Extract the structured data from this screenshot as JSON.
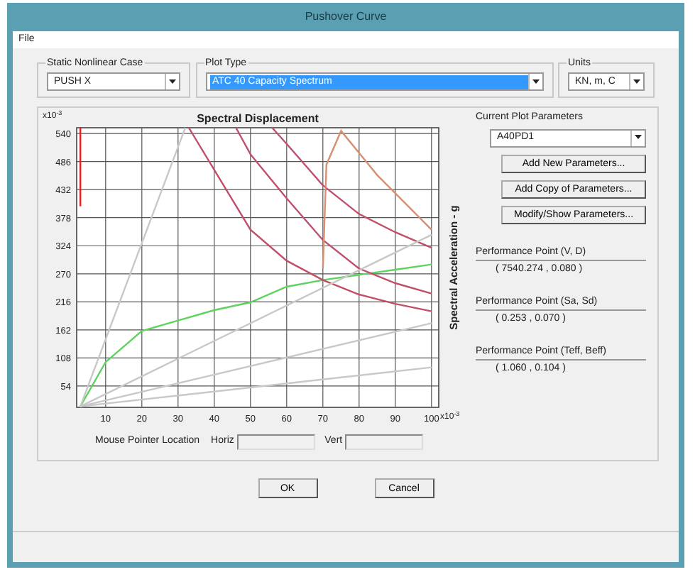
{
  "window": {
    "title": "Pushover Curve"
  },
  "menu": [
    "File"
  ],
  "static_case": {
    "label": "Static Nonlinear Case",
    "value": "PUSH X"
  },
  "plot_type": {
    "label": "Plot Type",
    "value": "ATC 40 Capacity Spectrum",
    "selected": true
  },
  "units": {
    "label": "Units",
    "value": "KN, m, C"
  },
  "chart": {
    "y_multiplier": "x10$^{-3}$",
    "x_multiplier": "x10$^{-3}$",
    "chart_data": {
      "type": "line",
      "grid": true,
      "title": "Spectral Displacement",
      "ylabel": "Spectral Acceleration - g",
      "xlim": [
        2,
        102
      ],
      "ylim": [
        13,
        551
      ],
      "xticks": [
        10,
        20,
        30,
        40,
        50,
        60,
        70,
        80,
        90,
        100
      ],
      "yticks": [
        54,
        108,
        162,
        216,
        270,
        324,
        378,
        432,
        486,
        540
      ],
      "series": [
        {
          "color": "#5fd35f",
          "x": [
            3,
            10,
            20,
            30,
            40,
            50,
            60,
            70,
            80,
            90,
            100
          ],
          "values": [
            15,
            100,
            160,
            180,
            200,
            215,
            245,
            258,
            268,
            278,
            288
          ]
        },
        {
          "color": "#c0506a",
          "x": [
            33,
            40,
            50,
            60,
            70,
            80,
            90,
            100
          ],
          "values": [
            551,
            470,
            355,
            295,
            258,
            230,
            212,
            198
          ]
        },
        {
          "color": "#c0506a",
          "x": [
            46,
            50,
            60,
            70,
            80,
            90,
            100
          ],
          "values": [
            551,
            500,
            415,
            335,
            280,
            252,
            232
          ]
        },
        {
          "color": "#c0506a",
          "x": [
            56,
            60,
            70,
            80,
            90,
            100
          ],
          "values": [
            551,
            520,
            440,
            385,
            350,
            320
          ]
        },
        {
          "color": "#d49070",
          "x": [
            70,
            71,
            75,
            85,
            100
          ],
          "values": [
            280,
            480,
            545,
            460,
            355
          ]
        },
        {
          "color": "#c8c8c8",
          "x": [
            3,
            32
          ],
          "values": [
            15,
            551
          ]
        },
        {
          "color": "#c8c8c8",
          "x": [
            3,
            100
          ],
          "values": [
            15,
            345
          ]
        },
        {
          "color": "#c8c8c8",
          "x": [
            3,
            100
          ],
          "values": [
            15,
            175
          ]
        },
        {
          "color": "#c8c8c8",
          "x": [
            3,
            100
          ],
          "values": [
            15,
            90
          ]
        },
        {
          "color": "#e02020",
          "x": [
            3,
            3
          ],
          "values": [
            400,
            551
          ]
        }
      ]
    }
  },
  "mouse_pointer": {
    "label": "Mouse Pointer Location",
    "fields": [
      {
        "label": "Horiz"
      },
      {
        "label": "Vert"
      }
    ]
  },
  "parameters": {
    "label": "Current Plot Parameters",
    "value": "A40PD1",
    "buttons": [
      "Add New Parameters...",
      "Add Copy of Parameters...",
      "Modify/Show Parameters..."
    ]
  },
  "performance_points": [
    {
      "label": "Performance Point (V, D)",
      "value": "( 7540.274 , 0.080 )"
    },
    {
      "label": "Performance Point (Sa, Sd)",
      "value": "( 0.253 , 0.070 )"
    },
    {
      "label": "Performance Point (Teff, Beff)",
      "value": "( 1.060 , 0.104 )"
    }
  ],
  "buttons": [
    "OK",
    "Cancel"
  ]
}
